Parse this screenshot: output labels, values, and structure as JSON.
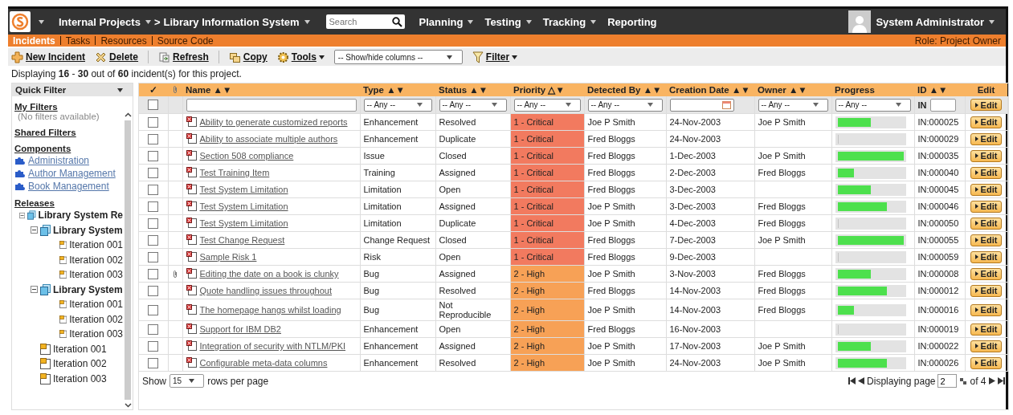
{
  "top_nav": {
    "project": "Internal Projects",
    "separator": ">",
    "product": "Library Information System",
    "search": {
      "placeholder": "Search"
    },
    "menu": [
      {
        "label": "Planning",
        "dropdown": true
      },
      {
        "label": "Testing",
        "dropdown": true
      },
      {
        "label": "Tracking",
        "dropdown": true
      },
      {
        "label": "Reporting",
        "dropdown": false
      }
    ],
    "user": "System Administrator"
  },
  "sub_tabs": [
    {
      "label": "Incidents",
      "selected": true
    },
    {
      "label": "Tasks",
      "selected": false
    },
    {
      "label": "Resources",
      "selected": false
    },
    {
      "label": "Source Code",
      "selected": false
    }
  ],
  "role": "Role: Project Owner",
  "toolbar": [
    {
      "kind": "button",
      "label": "New Incident",
      "dropdown": false
    },
    {
      "kind": "button",
      "label": "Delete",
      "dropdown": false
    },
    {
      "kind": "divider"
    },
    {
      "kind": "button",
      "label": "Refresh",
      "dropdown": false
    },
    {
      "kind": "divider"
    },
    {
      "kind": "button",
      "label": "Copy",
      "dropdown": false
    },
    {
      "kind": "button",
      "label": "Tools",
      "dropdown": true
    },
    {
      "kind": "select",
      "label": "-- Show/hide columns --"
    },
    {
      "kind": "button",
      "label": "Filter",
      "dropdown": true
    }
  ],
  "summary": "Displaying **16** - **30** out of **60** incident(s) for this project.",
  "sidebar": {
    "title": "Quick Filter",
    "my_filters": {
      "heading": "My Filters",
      "empty_text": "(No filters available)"
    },
    "shared_filters": {
      "heading": "Shared Filters"
    },
    "components": {
      "heading": "Components",
      "items": [
        "Administration",
        "Author Management",
        "Book Management"
      ]
    },
    "releases": {
      "heading": "Releases",
      "tree": [
        {
          "kind": "release",
          "label": "Library System Re",
          "expanded": true,
          "children": [
            {
              "kind": "release",
              "label": "Library System",
              "expanded": true,
              "children": [
                {
                  "kind": "iteration",
                  "label": "Iteration 001"
                },
                {
                  "kind": "iteration",
                  "label": "Iteration 002"
                },
                {
                  "kind": "iteration",
                  "label": "Iteration 003"
                }
              ]
            },
            {
              "kind": "release",
              "label": "Library System",
              "expanded": true,
              "children": [
                {
                  "kind": "iteration",
                  "label": "Iteration 001"
                },
                {
                  "kind": "iteration",
                  "label": "Iteration 002"
                },
                {
                  "kind": "iteration",
                  "label": "Iteration 003"
                }
              ]
            },
            {
              "kind": "iteration",
              "label": "Iteration 001"
            },
            {
              "kind": "iteration",
              "label": "Iteration 002"
            },
            {
              "kind": "iteration",
              "label": "Iteration 003"
            }
          ]
        }
      ]
    }
  },
  "table": {
    "columns": [
      {
        "kind": "check",
        "label": "✓"
      },
      {
        "kind": "attach"
      },
      {
        "kind": "text",
        "label": "Name",
        "sort": "▲▼"
      },
      {
        "kind": "text",
        "label": "Type",
        "sort": "▲▼"
      },
      {
        "kind": "text",
        "label": "Status",
        "sort": "▲▼"
      },
      {
        "kind": "text",
        "label": "Priority",
        "sort": "△▼"
      },
      {
        "kind": "text",
        "label": "Detected By",
        "sort": "▲▼"
      },
      {
        "kind": "text",
        "label": "Creation Date",
        "sort": "▲▼"
      },
      {
        "kind": "text",
        "label": "Owner",
        "sort": "▲▼"
      },
      {
        "kind": "text",
        "label": "Progress"
      },
      {
        "kind": "text",
        "label": "ID",
        "sort": "▲▼"
      },
      {
        "kind": "center",
        "label": "Edit"
      }
    ],
    "filters": [
      {
        "kind": "checkbox",
        "checked": false
      },
      {
        "kind": "none"
      },
      {
        "kind": "text"
      },
      {
        "kind": "select",
        "value": "-- Any --"
      },
      {
        "kind": "select",
        "value": "-- Any --"
      },
      {
        "kind": "select",
        "value": "-- Any --"
      },
      {
        "kind": "select",
        "value": "-- Any --"
      },
      {
        "kind": "date"
      },
      {
        "kind": "select",
        "value": "-- Any --"
      },
      {
        "kind": "select",
        "value": "-- Any --"
      },
      {
        "kind": "id",
        "prefix": "IN"
      },
      {
        "kind": "button",
        "label": "Edit"
      }
    ],
    "rows": [
      {
        "selected": false,
        "attachment": false,
        "name": "Ability to generate customized reports",
        "type": "Enhancement",
        "status": "Resolved",
        "priority": {
          "label": "1 - Critical",
          "color": "#f27a5f"
        },
        "detected_by": "Joe P Smith",
        "created": "24-Nov-2003",
        "owner": "Joe P Smith",
        "level": 0.5,
        "id": "IN:000025",
        "action": "Edit"
      },
      {
        "selected": false,
        "attachment": false,
        "name": "Ability to associate multiple authors",
        "type": "Enhancement",
        "status": "Duplicate",
        "priority": {
          "label": "1 - Critical",
          "color": "#f27a5f"
        },
        "detected_by": "Fred Bloggs",
        "created": "24-Nov-2003",
        "owner": "",
        "level": 0,
        "id": "IN:000029",
        "action": "Edit"
      },
      {
        "selected": false,
        "attachment": false,
        "name": "Section 508 compliance",
        "type": "Issue",
        "status": "Closed",
        "priority": {
          "label": "1 - Critical",
          "color": "#f27a5f"
        },
        "detected_by": "Fred Bloggs",
        "created": "1-Dec-2003",
        "owner": "Joe P Smith",
        "level": 1,
        "id": "IN:000035",
        "action": "Edit"
      },
      {
        "selected": false,
        "attachment": false,
        "name": "Test Training Item",
        "type": "Training",
        "status": "Assigned",
        "priority": {
          "label": "1 - Critical",
          "color": "#f27a5f"
        },
        "detected_by": "Fred Bloggs",
        "created": "2-Dec-2003",
        "owner": "Fred Bloggs",
        "level": 0.25,
        "id": "IN:000040",
        "action": "Edit"
      },
      {
        "selected": false,
        "attachment": false,
        "name": "Test System Limitation",
        "type": "Limitation",
        "status": "Open",
        "priority": {
          "label": "1 - Critical",
          "color": "#f27a5f"
        },
        "detected_by": "Fred Bloggs",
        "created": "3-Dec-2003",
        "owner": "",
        "level": 0.5,
        "id": "IN:000045",
        "action": "Edit"
      },
      {
        "selected": false,
        "attachment": false,
        "name": "Test System Limitation",
        "type": "Limitation",
        "status": "Assigned",
        "priority": {
          "label": "1 - Critical",
          "color": "#f27a5f"
        },
        "detected_by": "Joe P Smith",
        "created": "3-Dec-2003",
        "owner": "Fred Bloggs",
        "level": 0.75,
        "id": "IN:000046",
        "action": "Edit"
      },
      {
        "selected": false,
        "attachment": false,
        "name": "Test System Limitation",
        "type": "Limitation",
        "status": "Duplicate",
        "priority": {
          "label": "1 - Critical",
          "color": "#f27a5f"
        },
        "detected_by": "Joe P Smith",
        "created": "4-Dec-2003",
        "owner": "Fred Bloggs",
        "level": 0,
        "id": "IN:000050",
        "action": "Edit"
      },
      {
        "selected": false,
        "attachment": false,
        "name": "Test Change Request",
        "type": "Change Request",
        "status": "Closed",
        "priority": {
          "label": "1 - Critical",
          "color": "#f27a5f"
        },
        "detected_by": "Fred Bloggs",
        "created": "7-Dec-2003",
        "owner": "Joe P Smith",
        "level": 1,
        "id": "IN:000055",
        "action": "Edit"
      },
      {
        "selected": false,
        "attachment": false,
        "name": "Sample Risk 1",
        "type": "Risk",
        "status": "Open",
        "priority": {
          "label": "1 - Critical",
          "color": "#f27a5f"
        },
        "detected_by": "Fred Bloggs",
        "created": "9-Dec-2003",
        "owner": "",
        "level": 0,
        "id": "IN:000059",
        "action": "Edit"
      },
      {
        "selected": false,
        "attachment": true,
        "name": "Editing the date on a book is clunky",
        "type": "Bug",
        "status": "Assigned",
        "priority": {
          "label": "2 - High",
          "color": "#f7a156"
        },
        "detected_by": "Joe P Smith",
        "created": "3-Nov-2003",
        "owner": "Fred Bloggs",
        "level": 0.5,
        "id": "IN:000008",
        "action": "Edit"
      },
      {
        "selected": false,
        "attachment": false,
        "name": "Quote handling issues throughout",
        "type": "Bug",
        "status": "Resolved",
        "priority": {
          "label": "2 - High",
          "color": "#f7a156"
        },
        "detected_by": "Fred Bloggs",
        "created": "14-Nov-2003",
        "owner": "Fred Bloggs",
        "level": 0.75,
        "id": "IN:000012",
        "action": "Edit"
      },
      {
        "selected": false,
        "attachment": false,
        "name": "The homepage hangs whilst loading",
        "type": "Bug",
        "status": "Not Reproducible",
        "priority": {
          "label": "2 - High",
          "color": "#f7a156"
        },
        "detected_by": "Joe P Smith",
        "created": "14-Nov-2003",
        "owner": "Fred Bloggs",
        "level": 0.25,
        "id": "IN:000016",
        "action": "Edit"
      },
      {
        "selected": false,
        "attachment": false,
        "name": "Support for IBM DB2",
        "type": "Enhancement",
        "status": "Open",
        "priority": {
          "label": "2 - High",
          "color": "#f7a156"
        },
        "detected_by": "Fred Bloggs",
        "created": "16-Nov-2003",
        "owner": "",
        "level": 0,
        "id": "IN:000019",
        "action": "Edit"
      },
      {
        "selected": false,
        "attachment": false,
        "name": "Integration of security with NTLM/PKI",
        "type": "Enhancement",
        "status": "Assigned",
        "priority": {
          "label": "2 - High",
          "color": "#f7a156"
        },
        "detected_by": "Joe P Smith",
        "created": "17-Nov-2003",
        "owner": "Joe P Smith",
        "level": 0.5,
        "id": "IN:000022",
        "action": "Edit"
      },
      {
        "selected": false,
        "attachment": false,
        "name": "Configurable meta-data columns",
        "type": "Enhancement",
        "status": "Resolved",
        "priority": {
          "label": "2 - High",
          "color": "#f7a156"
        },
        "detected_by": "Joe P Smith",
        "created": "24-Nov-2003",
        "owner": "Joe P Smith",
        "level": 0.75,
        "id": "IN:000026",
        "action": "Edit"
      }
    ],
    "footer": {
      "show_label": "Show",
      "page_size": "15",
      "rows_label": "rows per page",
      "page_label": "Displaying page",
      "page": "2",
      "of_label": "of 4"
    }
  }
}
